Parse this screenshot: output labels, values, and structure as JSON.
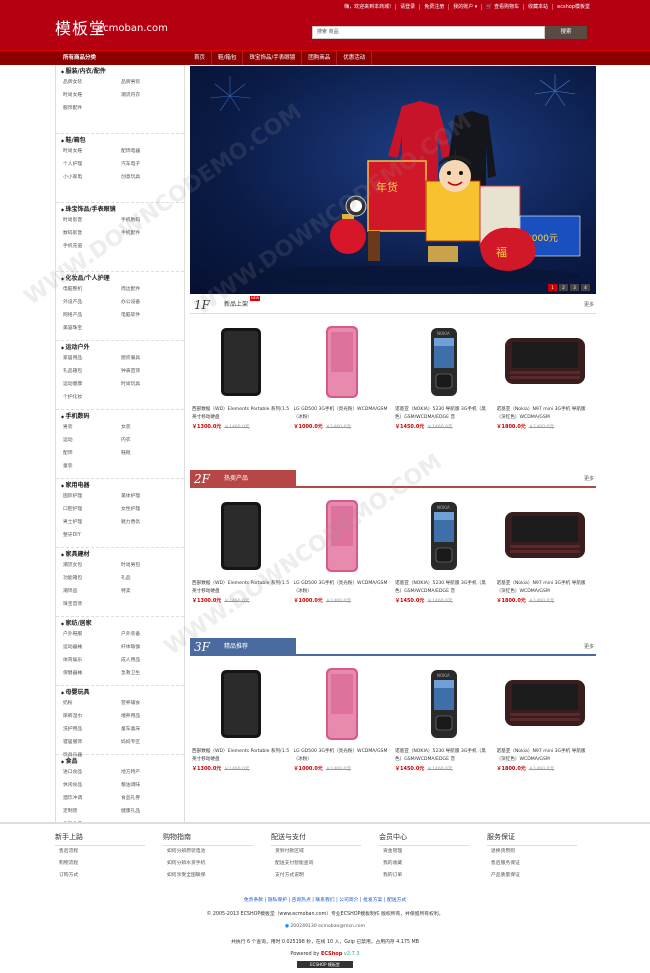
{
  "header": {
    "logo_cn": "模板堂",
    "logo_en": "ecmoban.com",
    "top_links": [
      "嗨，欢迎来到本商城!",
      "请登录",
      "免费注册",
      "我的账户 ▾",
      "🛒 查看购物车",
      "收藏本站",
      "ecshop模板堂"
    ],
    "search_placeholder": "搜索 商品",
    "search_button": "搜索"
  },
  "nav": {
    "category_title": "所有商品分类",
    "items": [
      "首页",
      "鞋/箱包",
      "珠宝饰品/手表眼镜",
      "团购商品",
      "优惠活动"
    ]
  },
  "sidebar": [
    {
      "title": "服装/内衣/配件",
      "subs": [
        "品牌女装",
        "品牌男装",
        "时尚女鞋",
        "潮流内衣",
        "服饰配件"
      ]
    },
    {
      "title": "鞋/箱包",
      "subs": [
        "时尚女鞋",
        "配饰电器",
        "个人护理",
        "汽车电子",
        "小小家电",
        "创意玩具"
      ]
    },
    {
      "title": "珠宝饰品/手表眼镜",
      "subs": [
        "时尚影音",
        "手机数码",
        "数码影音",
        "手机配件",
        "手机充值"
      ]
    },
    {
      "title": "化妆品/个人护理",
      "subs": [
        "电脑整机",
        "周边配件",
        "外设产品",
        "办公设备",
        "网络产品",
        "电脑软件",
        "美容珠宝"
      ]
    },
    {
      "title": "运动户外",
      "subs": [
        "家居用品",
        "厨房餐具",
        "礼品箱包",
        "钟表首饰",
        "运动健康",
        "时尚玩具",
        "个护化妆"
      ]
    },
    {
      "title": "手机数码",
      "subs": [
        "男装",
        "女装",
        "运动",
        "内衣",
        "配饰",
        "鞋靴",
        "童装"
      ]
    },
    {
      "title": "家用电器",
      "subs": [
        "国际护理",
        "美体护理",
        "口腔护理",
        "女性护理",
        "男士护理",
        "魅力香氛",
        "整牙DIY"
      ]
    },
    {
      "title": "家具建材",
      "subs": [
        "潮流女包",
        "时尚男包",
        "功能箱包",
        "礼品",
        "潮饰品",
        "特卖",
        "珠宝首饰"
      ]
    },
    {
      "title": "家纺/居家",
      "subs": [
        "户外鞋服",
        "户外装备",
        "运动器械",
        "纤体瑜伽",
        "体育娱乐",
        "成人用品",
        "保健器械",
        "急救卫生"
      ]
    },
    {
      "title": "母婴玩具",
      "subs": [
        "奶粉",
        "营养辅食",
        "尿裤湿巾",
        "喂养用品",
        "洗护用品",
        "童车童床",
        "寝居服饰",
        "妈妈专区",
        "玩具乐器"
      ]
    },
    {
      "title": "食品",
      "subs": [
        "进口食品",
        "地方特产",
        "休闲食品",
        "粮油调味",
        "酒饮冲调",
        "食品礼券",
        "定制馈",
        "健康礼品",
        "生鲜食品"
      ]
    }
  ],
  "banner": {
    "dots": [
      "1",
      "2",
      "3",
      "4"
    ]
  },
  "products": [
    {
      "name": "西部数据（WD）Elements Portable 系列(1.5英寸移动硬盘",
      "price": "￥1300.0元",
      "old": "￥1460.0元",
      "kind": "tablet"
    },
    {
      "name": "LG GD500 3G手机（亮光粉）WCDMA/GSM（冰粉）",
      "price": "￥1000.0元",
      "old": "￥1460.0元",
      "kind": "pink"
    },
    {
      "name": "诺基亚（NOKIA）5230 导航版 3G手机（黑色）GSM/WCDMA/EDGE 音",
      "price": "￥1450.0元",
      "old": "￥1460.0元",
      "kind": "nokia"
    },
    {
      "name": "诺基亚（Nokia）N97 mini 3G手机 导航版（深红色）WCDMA/GSM",
      "price": "￥1800.0元",
      "old": "￥1460.0元",
      "kind": "slider"
    }
  ],
  "floors": [
    {
      "num": "1F",
      "title": "新品上架",
      "badge": "NEW",
      "style": "plain",
      "more": "更多"
    },
    {
      "num": "2F",
      "title": "热卖产品",
      "badge": "",
      "style": "red",
      "more": "更多"
    },
    {
      "num": "3F",
      "title": "精品推荐",
      "badge": "",
      "style": "blue",
      "more": "更多"
    }
  ],
  "footer": {
    "columns": [
      {
        "title": "新手上路",
        "items": [
          "售后流程",
          "购物流程",
          "订购方式"
        ]
      },
      {
        "title": "购物指南",
        "items": [
          "如何分辨原装电池",
          "如何分辨水货手机",
          "如何享受全国联保"
        ]
      },
      {
        "title": "配送与支付",
        "items": [
          "货到付款区域",
          "配送支付智能查询",
          "支付方式说明"
        ]
      },
      {
        "title": "会员中心",
        "items": [
          "资金管理",
          "我的收藏",
          "我的订单"
        ]
      },
      {
        "title": "服务保证",
        "items": [
          "退换货原则",
          "售后服务保证",
          "产品质量保证"
        ]
      }
    ],
    "links": "免责条款 | 隐私保护 | 咨询热点 | 联系我们 | 公司简介 | 批发方案 | 配送方式",
    "copyright": "© 2005-2013 ECSHOP模板堂（www.ecmoban.com）专业ECSHOP模板制作 版权所有，并保留所有权利。",
    "qq": "200249130    ecmoban@msn.com",
    "exec": "共执行 6 个查询，用时 0.025198 秒，在线 10 人，Gzip 已禁用，占用内存 4.175 MB",
    "powered_prefix": "Powered by ",
    "powered_brand": "ECShop",
    "powered_version": " v2.7.3",
    "badge": "ECSHOP 模板堂"
  },
  "watermark": "WWW.DOWNCODEMO.COM",
  "colors": {
    "brand_red": "#b50012",
    "nav_dark": "#8b0000",
    "floor2": "#b74747",
    "floor3": "#4a6aa0",
    "price": "#cc0000"
  }
}
